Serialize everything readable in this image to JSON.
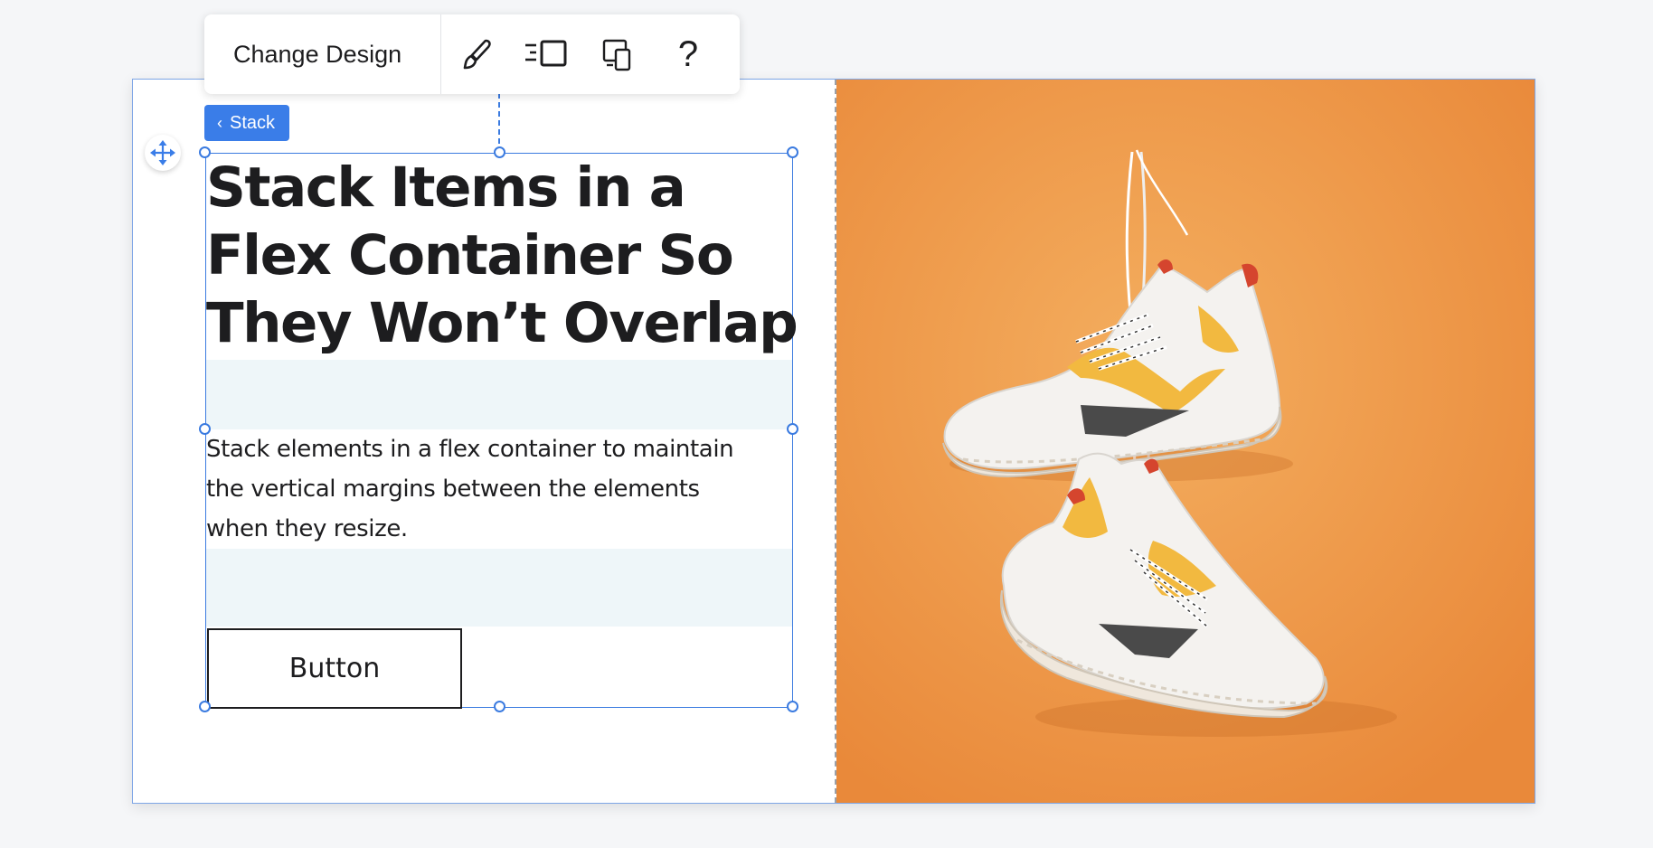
{
  "toolbar": {
    "change_design_label": "Change Design",
    "help_label": "?",
    "icons": [
      "paintbrush-icon",
      "stack-layout-icon",
      "devices-icon",
      "help-icon"
    ]
  },
  "breadcrumb": {
    "chevron": "‹",
    "label": "Stack"
  },
  "content": {
    "heading_lines": [
      "Stack Items in a",
      "Flex Container So",
      "They Won’t Overlap"
    ],
    "paragraph_lines": [
      "Stack elements in a flex container to maintain",
      "the vertical margins between the elements",
      "when they resize."
    ],
    "button_label": "Button"
  },
  "image": {
    "subject": "sneakers-image"
  },
  "colors": {
    "selection": "#3b7be0",
    "tag_background": "#3a7de8",
    "gap_band": "#eef6f9",
    "image_background": "#ef9a45",
    "text": "#1d1d1f"
  }
}
